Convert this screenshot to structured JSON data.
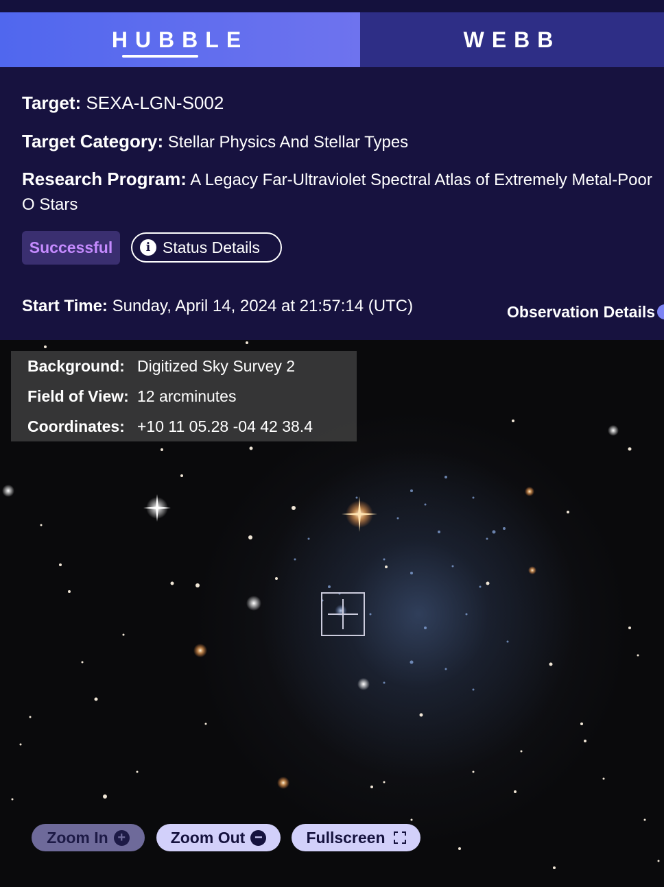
{
  "tabs": [
    {
      "label": "HUBBLE",
      "active": true
    },
    {
      "label": "WEBB",
      "active": false
    }
  ],
  "observation": {
    "target_label": "Target:",
    "target_value": "SEXA-LGN-S002",
    "category_label": "Target Category:",
    "category_value": "Stellar Physics And Stellar Types",
    "program_label": "Research Program:",
    "program_value": "A Legacy Far-Ultraviolet Spectral Atlas of Extremely Metal-Poor O Stars",
    "status_badge": "Successful",
    "status_details_label": "Status Details",
    "start_time_label": "Start Time:",
    "start_time_value": "Sunday, April 14, 2024 at 21:57:14 (UTC)",
    "observation_details_link": "Observation Details"
  },
  "sky_view": {
    "background_label": "Background:",
    "background_value": "Digitized Sky Survey 2",
    "fov_label": "Field of View:",
    "fov_value": "12 arcminutes",
    "coords_label": "Coordinates:",
    "coords_value": "+10 11 05.28 -04 42 38.4"
  },
  "controls": {
    "zoom_in": "Zoom In",
    "zoom_out": "Zoom Out",
    "fullscreen": "Fullscreen"
  },
  "icons": {
    "info": "info-icon",
    "zoom_in": "plus-circle-icon",
    "zoom_out": "minus-circle-icon",
    "fullscreen": "expand-icon"
  },
  "colors": {
    "header_bg": "#17123f",
    "tab_active": "#5a6cee",
    "tab_inactive": "#2e2e86",
    "badge_text": "#c58bff",
    "button_bg": "#d2d0fa"
  }
}
